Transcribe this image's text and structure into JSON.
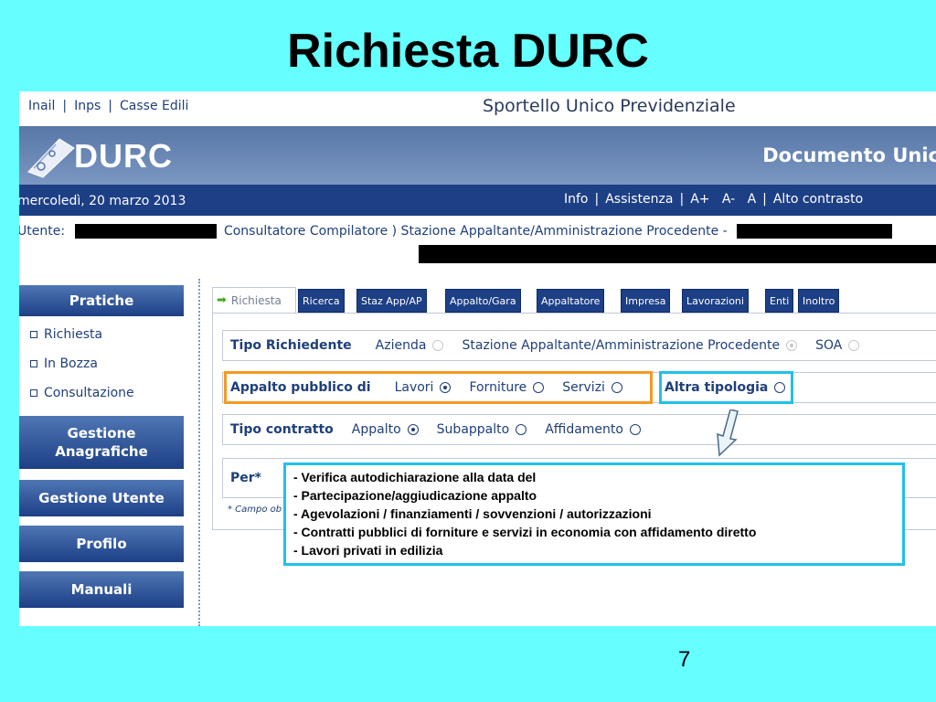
{
  "slide": {
    "title": "Richiesta DURC",
    "page_number": "7"
  },
  "topbar": {
    "links": [
      "Inail",
      "Inps",
      "Casse Edili"
    ],
    "separator": "|",
    "portal_title": "Sportello Unico Previdenziale"
  },
  "banner": {
    "logo_text": "DURC",
    "doc_title": "Documento Unic"
  },
  "datebar": {
    "date": "mercoledì, 20 marzo 2013",
    "menu": [
      "Info",
      "Assistenza",
      "A+",
      "A-",
      "A",
      "Alto contrasto"
    ]
  },
  "userline": {
    "label": "Utente:",
    "roles": "Consultatore Compilatore ) Stazione Appaltante/Amministrazione Procedente -"
  },
  "sidebar": {
    "pratiche": "Pratiche",
    "links": [
      "Richiesta",
      "In Bozza",
      "Consultazione"
    ],
    "gestione_anagrafiche_1": "Gestione",
    "gestione_anagrafiche_2": "Anagrafiche",
    "gestione_utente": "Gestione Utente",
    "profilo": "Profilo",
    "manuali": "Manuali"
  },
  "tabs": [
    "Richiesta",
    "Ricerca",
    "Staz App/AP",
    "Appalto/Gara",
    "Appaltatore",
    "Impresa",
    "Lavorazioni",
    "Enti",
    "Inoltro"
  ],
  "form": {
    "tipo_richiedente": {
      "label": "Tipo Richiedente",
      "options": [
        "Azienda",
        "Stazione Appaltante/Amministrazione Procedente",
        "SOA"
      ]
    },
    "appalto_pubblico": {
      "label": "Appalto pubblico di",
      "options": [
        "Lavori",
        "Forniture",
        "Servizi"
      ]
    },
    "altra_tipologia": "Altra tipologia",
    "tipo_contratto": {
      "label": "Tipo contratto",
      "options": [
        "Appalto",
        "Subappalto",
        "Affidamento"
      ]
    },
    "per_label": "Per*",
    "campo_note": "* Campo ob"
  },
  "callout": {
    "lines": [
      "- Verifica autodichiarazione alla data del",
      "- Partecipazione/aggiudicazione appalto",
      "- Agevolazioni / finanziamenti / sovvenzioni / autorizzazioni",
      "- Contratti pubblici di forniture e servizi in economia con affidamento diretto",
      "- Lavori privati in edilizia"
    ]
  },
  "colors": {
    "background": "#66ffff",
    "nav_blue": "#1d3f86",
    "text_blue": "#1f3f7a",
    "highlight_orange": "#f59a23",
    "highlight_cyan": "#22c0e8"
  }
}
